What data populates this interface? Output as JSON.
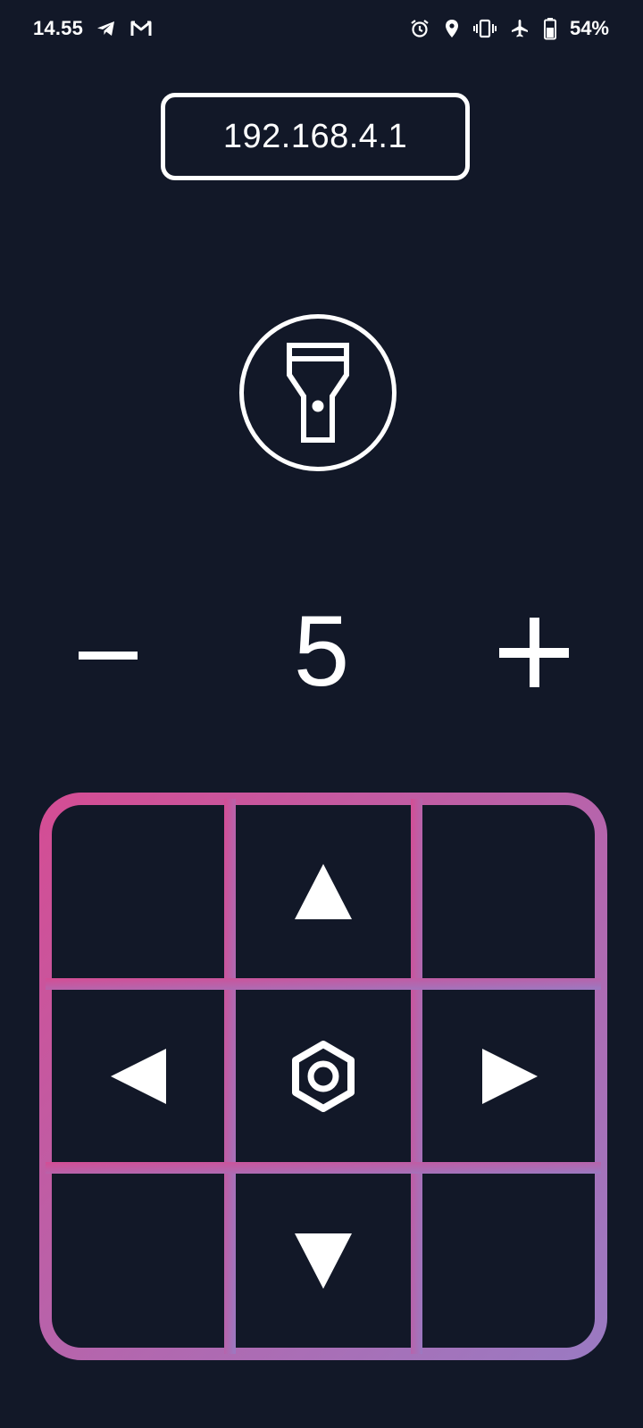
{
  "status_bar": {
    "time": "14.55",
    "left_icons": [
      "telegram-icon",
      "gmail-icon"
    ],
    "right_icons": [
      "alarm-icon",
      "location-icon",
      "vibrate-icon",
      "airplane-icon",
      "battery-icon"
    ],
    "battery_percent": "54%"
  },
  "connection": {
    "ip_address": "192.168.4.1"
  },
  "flashlight": {
    "icon": "flashlight-icon"
  },
  "speed": {
    "value": "5",
    "decrease_icon": "minus-icon",
    "increase_icon": "plus-icon"
  },
  "dpad": {
    "up_icon": "arrow-up-icon",
    "left_icon": "arrow-left-icon",
    "center_icon": "hex-nut-icon",
    "right_icon": "arrow-right-icon",
    "down_icon": "arrow-down-icon",
    "gradient_start": "#d44d94",
    "gradient_end": "#9a7ac2"
  },
  "colors": {
    "background": "#121828",
    "foreground": "#ffffff"
  }
}
